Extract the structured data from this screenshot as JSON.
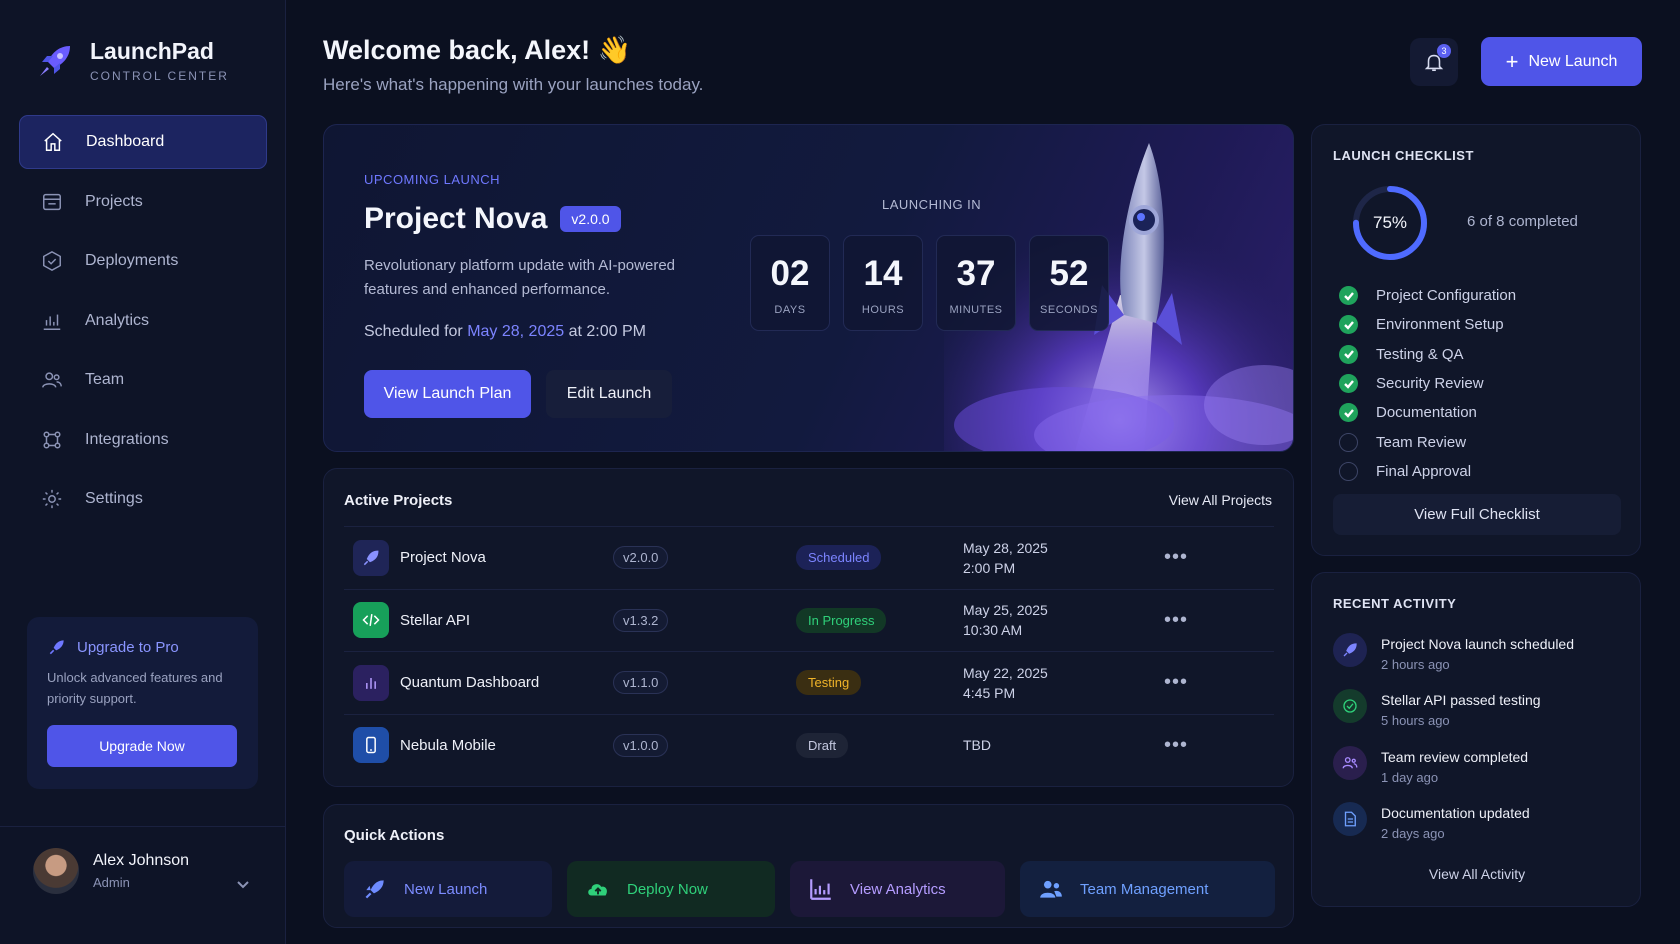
{
  "brand": {
    "name": "LaunchPad",
    "subtitle": "CONTROL CENTER"
  },
  "nav": {
    "items": [
      {
        "label": "Dashboard",
        "icon": "home-icon",
        "active": true
      },
      {
        "label": "Projects",
        "icon": "folder-icon"
      },
      {
        "label": "Deployments",
        "icon": "package-icon"
      },
      {
        "label": "Analytics",
        "icon": "bar-chart-icon"
      },
      {
        "label": "Team",
        "icon": "users-icon"
      },
      {
        "label": "Integrations",
        "icon": "integrations-icon"
      },
      {
        "label": "Settings",
        "icon": "gear-icon"
      }
    ]
  },
  "upgrade": {
    "title": "Upgrade to Pro",
    "description": "Unlock advanced features and priority support.",
    "button": "Upgrade Now"
  },
  "user": {
    "name": "Alex Johnson",
    "role": "Admin"
  },
  "header": {
    "welcome": "Welcome back, Alex! 👋",
    "subtitle": "Here's what's happening with your launches today.",
    "notification_count": "3",
    "new_launch": "New Launch"
  },
  "hero": {
    "label": "UPCOMING LAUNCH",
    "title": "Project Nova",
    "version": "v2.0.0",
    "description": "Revolutionary platform update with AI-powered features and enhanced performance.",
    "scheduled_prefix": "Scheduled for",
    "scheduled_date": "May 28, 2025",
    "scheduled_suffix": "at 2:00 PM",
    "primary_button": "View Launch Plan",
    "secondary_button": "Edit Launch",
    "countdown_label": "LAUNCHING IN",
    "countdown": [
      {
        "value": "02",
        "unit": "DAYS"
      },
      {
        "value": "14",
        "unit": "HOURS"
      },
      {
        "value": "37",
        "unit": "MINUTES"
      },
      {
        "value": "52",
        "unit": "SECONDS"
      }
    ]
  },
  "checklist": {
    "title": "LAUNCH CHECKLIST",
    "percent": "75%",
    "progress": 0.75,
    "completed_text": "6 of 8 completed",
    "items": [
      {
        "label": "Project Configuration",
        "done": true
      },
      {
        "label": "Environment Setup",
        "done": true
      },
      {
        "label": "Testing & QA",
        "done": true
      },
      {
        "label": "Security Review",
        "done": true
      },
      {
        "label": "Documentation",
        "done": true
      },
      {
        "label": "Team Review",
        "done": false
      },
      {
        "label": "Final Approval",
        "done": false
      }
    ],
    "button": "View Full Checklist"
  },
  "activity": {
    "title": "RECENT ACTIVITY",
    "items": [
      {
        "title": "Project Nova launch scheduled",
        "time": "2 hours ago",
        "icon": "rocket-icon"
      },
      {
        "title": "Stellar API passed testing",
        "time": "5 hours ago",
        "icon": "check-circle-icon"
      },
      {
        "title": "Team review completed",
        "time": "1 day ago",
        "icon": "users-icon"
      },
      {
        "title": "Documentation updated",
        "time": "2 days ago",
        "icon": "document-icon"
      }
    ],
    "view_all": "View All Activity"
  },
  "projects": {
    "title": "Active Projects",
    "view_all": "View All Projects",
    "rows": [
      {
        "name": "Project Nova",
        "version": "v2.0.0",
        "status": "Scheduled",
        "date": "May 28, 2025",
        "time": "2:00 PM",
        "icon": "rocket-icon"
      },
      {
        "name": "Stellar API",
        "version": "v1.3.2",
        "status": "In Progress",
        "date": "May 25, 2025",
        "time": "10:30 AM",
        "icon": "code-icon"
      },
      {
        "name": "Quantum Dashboard",
        "version": "v1.1.0",
        "status": "Testing",
        "date": "May 22, 2025",
        "time": "4:45 PM",
        "icon": "bar-chart-icon"
      },
      {
        "name": "Nebula Mobile",
        "version": "v1.0.0",
        "status": "Draft",
        "date": "TBD",
        "time": "",
        "icon": "mobile-icon"
      }
    ]
  },
  "quick_actions": {
    "title": "Quick Actions",
    "items": [
      {
        "label": "New Launch",
        "icon": "rocket-icon"
      },
      {
        "label": "Deploy Now",
        "icon": "cloud-upload-icon"
      },
      {
        "label": "View Analytics",
        "icon": "bar-chart-icon"
      },
      {
        "label": "Team Management",
        "icon": "users-icon"
      }
    ]
  },
  "colors": {
    "accent": "#4f55e8",
    "success": "#1fa35c",
    "warning": "#f0b429",
    "background": "#0b1020"
  }
}
